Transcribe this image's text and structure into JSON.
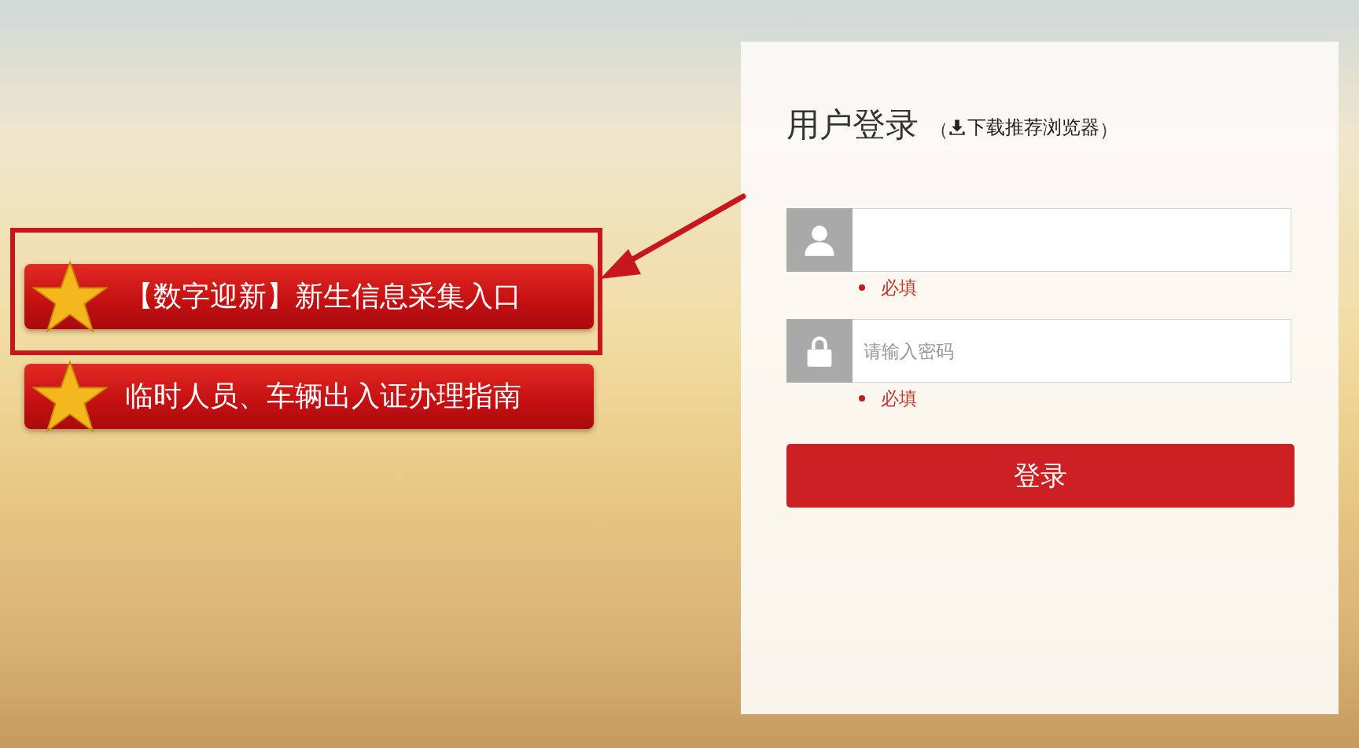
{
  "banners": [
    {
      "label": "【数字迎新】新生信息采集入口",
      "highlighted": true
    },
    {
      "label": "临时人员、车辆出入证办理指南",
      "highlighted": false
    }
  ],
  "login": {
    "title": "用户登录",
    "brackets": [
      "（",
      "）"
    ],
    "download_link": "下载推荐浏览器",
    "fields": [
      {
        "kind": "user",
        "hint": "必填"
      },
      {
        "kind": "password",
        "placeholder": "请输入密码",
        "hint": "必填"
      }
    ],
    "button": "登录"
  }
}
